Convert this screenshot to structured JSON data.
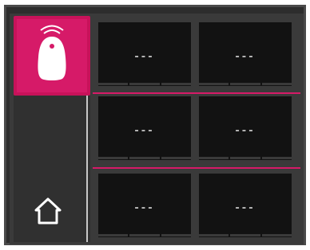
{
  "sensors": [
    {
      "value": "---"
    },
    {
      "value": "---"
    },
    {
      "value": "---"
    },
    {
      "value": "---"
    },
    {
      "value": "---"
    },
    {
      "value": "---"
    }
  ],
  "colors": {
    "accent": "#d61a68",
    "background": "#2d2d2d",
    "cell": "#121212"
  },
  "icons": {
    "device": "device-icon",
    "home": "home-icon"
  }
}
